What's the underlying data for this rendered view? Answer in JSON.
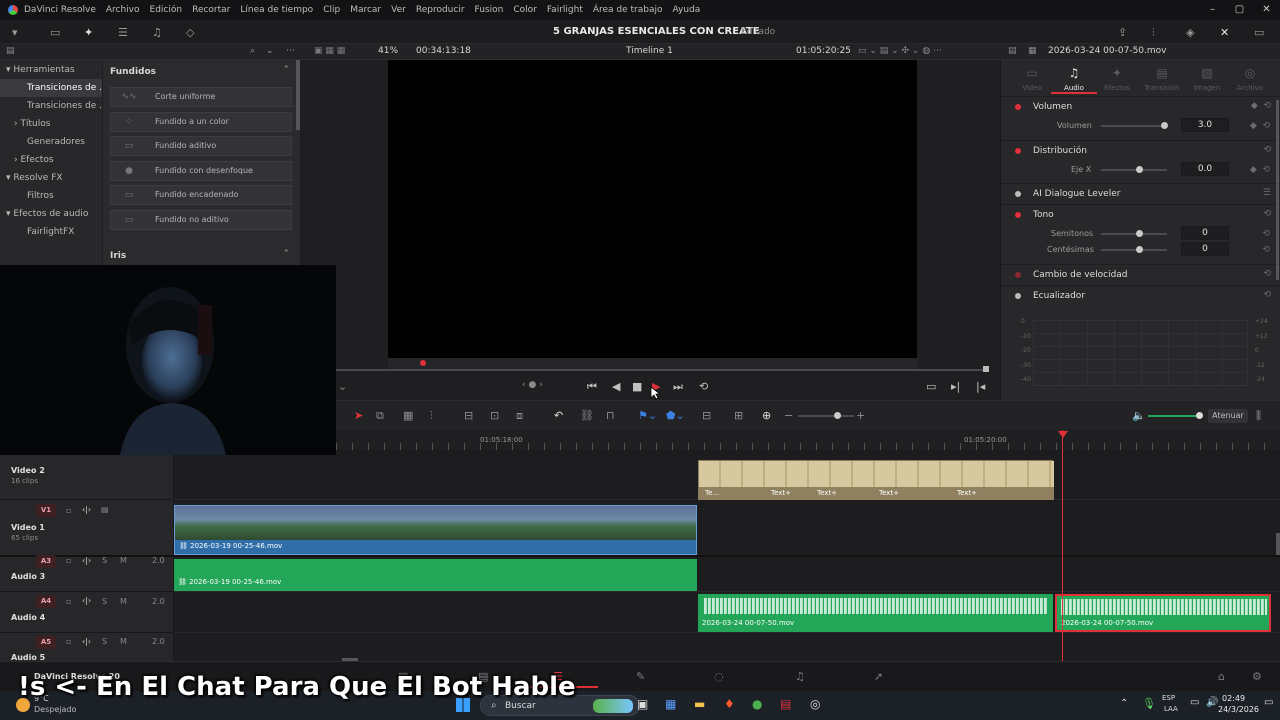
{
  "app": {
    "name": "DaVinci Resolve"
  },
  "menu": [
    "Archivo",
    "Edición",
    "Recortar",
    "Línea de tiempo",
    "Clip",
    "Marcar",
    "Ver",
    "Reproducir",
    "Fusion",
    "Color",
    "Fairlight",
    "Área de trabajo",
    "Ayuda"
  ],
  "project": {
    "title": "5 GRANJAS ESENCIALES CON CREATE",
    "status": "Editado"
  },
  "viewer_bar": {
    "zoom": "41%",
    "source_tc": "00:34:13:18",
    "timeline_name": "Timeline 1",
    "record_tc": "01:05:20:25",
    "clip_name": "2026-03-24 00-07-50.mov"
  },
  "effects_tree": [
    {
      "label": "Herramientas",
      "expanded": true,
      "indent": 0
    },
    {
      "label": "Transiciones de ...",
      "selected": true,
      "indent": 1
    },
    {
      "label": "Transiciones de ...",
      "indent": 1
    },
    {
      "label": "Títulos",
      "indent": 1,
      "collapsed": true
    },
    {
      "label": "Generadores",
      "indent": 1
    },
    {
      "label": "Efectos",
      "indent": 1,
      "collapsed": true
    },
    {
      "label": "Resolve FX",
      "indent": 0,
      "expanded": true
    },
    {
      "label": "Filtros",
      "indent": 1
    },
    {
      "label": "Efectos de audio",
      "indent": 0,
      "expanded": true
    },
    {
      "label": "FairlightFX",
      "indent": 1
    }
  ],
  "fx_panel": {
    "heading": "Fundidos",
    "items": [
      "Corte uniforme",
      "Fundido a un color",
      "Fundido aditivo",
      "Fundido con desenfoque",
      "Fundido encadenado",
      "Fundido no aditivo"
    ],
    "next_heading": "Iris"
  },
  "inspector": {
    "tabs": [
      "Video",
      "Audio",
      "Efectos",
      "Transición",
      "Imagen",
      "Archivo"
    ],
    "active_tab": "Audio",
    "sections": {
      "volume": {
        "title": "Volumen",
        "param": "Volumen",
        "value": "3.0"
      },
      "distribution": {
        "title": "Distribución",
        "param": "Eje X",
        "value": "0.0"
      },
      "ai_leveler": {
        "title": "AI Dialogue Leveler"
      },
      "tone": {
        "title": "Tono",
        "semitones_label": "Semitonos",
        "semitones": "0",
        "cents_label": "Centésimas",
        "cents": "0"
      },
      "speed": {
        "title": "Cambio de velocidad"
      },
      "eq": {
        "title": "Ecualizador",
        "db_left": [
          "0",
          "-10",
          "-20",
          "-30",
          "-40"
        ],
        "db_right": [
          "+24",
          "+12",
          "0",
          "-12",
          "-24"
        ]
      }
    }
  },
  "timeline_toolbar": {
    "mute_label": "Atenuar"
  },
  "ruler": {
    "timecodes": [
      "01:05:18:00",
      "01:05:20:00"
    ]
  },
  "tracks": [
    {
      "id": "Video 2",
      "clips": "16 clips"
    },
    {
      "id": "V1",
      "name": "Video 1",
      "clips": "65 clips"
    },
    {
      "id": "A3",
      "name": "Audio 3",
      "level": "2.0"
    },
    {
      "id": "A4",
      "name": "Audio 4",
      "level": "2.0"
    },
    {
      "id": "A5",
      "name": "Audio 5",
      "level": "2.0"
    }
  ],
  "clips": {
    "video1": "2026-03-19 00-25-46.mov",
    "audio3": "2026-03-19 00-25-46.mov",
    "audio4_a": "2026-03-24 00-07-50.mov",
    "audio4_b": "2026-03-24 00-07-50.mov",
    "text_labels": [
      "Te...",
      "Text+",
      "Text+",
      "Text+",
      "Text+"
    ]
  },
  "page_badge": {
    "version": "DaVinci Resolve 20"
  },
  "weather": {
    "temp": "9°C",
    "desc": "Despejado"
  },
  "taskbar": {
    "search_placeholder": "Buscar",
    "lang": "ESP",
    "lang2": "LAA",
    "time": "02:49",
    "date": "24/3/2026"
  },
  "overlay": {
    "text": "!s <- En El Chat Para Que El Bot Hable"
  },
  "colors": {
    "accent_red": "#e0303a",
    "clip_blue": "#2f6ea8",
    "clip_green": "#23a657",
    "title_clip": "#c9b98a"
  }
}
